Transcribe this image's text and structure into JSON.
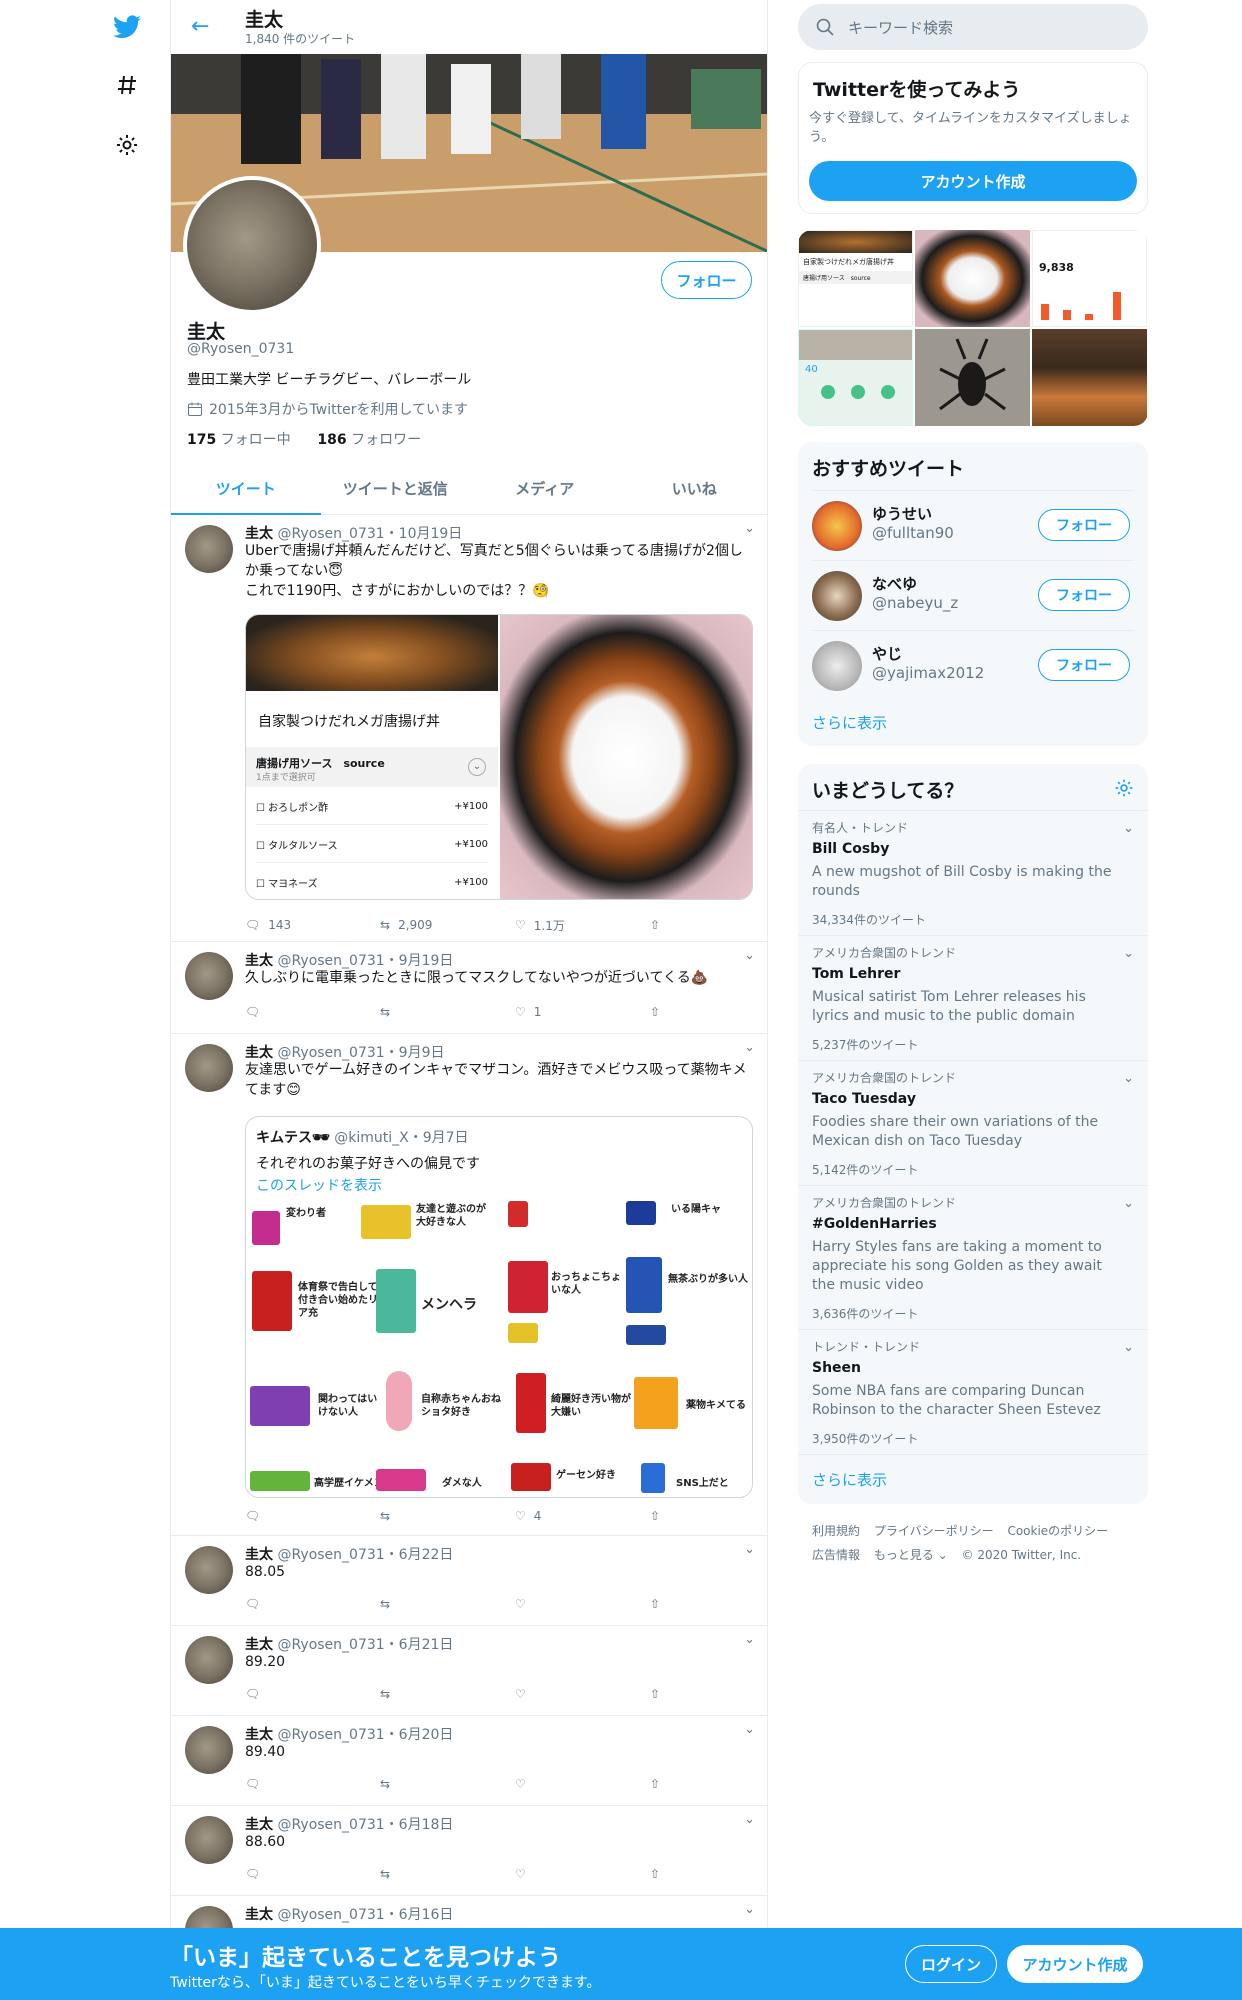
{
  "header": {
    "name": "圭太",
    "tweet_count": "1,840 件のツイート"
  },
  "profile": {
    "name": "圭太",
    "handle": "@Ryosen_0731",
    "bio": "豊田工業大学 ビーチラグビー、バレーボール",
    "joined": "2015年3月からTwitterを利用しています",
    "following_count": "175",
    "following_label": "フォロー中",
    "followers_count": "186",
    "followers_label": "フォロワー",
    "follow_button": "フォロー"
  },
  "tabs": [
    "ツイート",
    "ツイートと返信",
    "メディア",
    "いいね"
  ],
  "tweets": [
    {
      "name": "圭太",
      "meta": "@Ryosen_0731・10月19日",
      "text": "Uberで唐揚げ丼頼んだんだけど、写真だと5個ぐらいは乗ってる唐揚げが2個しか乗ってない😇\nこれで1190円、さすがにおかしいのでは？？🧐",
      "replies": "143",
      "retweets": "2,909",
      "likes": "1.1万"
    },
    {
      "name": "圭太",
      "meta": "@Ryosen_0731・9月19日",
      "text": "久しぶりに電車乗ったときに限ってマスクしてないやつが近づいてくる💩",
      "replies": "",
      "retweets": "",
      "likes": "1"
    },
    {
      "name": "圭太",
      "meta": "@Ryosen_0731・9月9日",
      "text": "友達思いでゲーム好きのインキャでマザコン。酒好きでメビウス吸って薬物キメてます😊",
      "replies": "",
      "retweets": "",
      "likes": "4"
    },
    {
      "name": "圭太",
      "meta": "@Ryosen_0731・6月22日",
      "text": "88.05",
      "replies": "",
      "retweets": "",
      "likes": ""
    },
    {
      "name": "圭太",
      "meta": "@Ryosen_0731・6月21日",
      "text": "89.20",
      "replies": "",
      "retweets": "",
      "likes": ""
    },
    {
      "name": "圭太",
      "meta": "@Ryosen_0731・6月20日",
      "text": "89.40",
      "replies": "",
      "retweets": "",
      "likes": ""
    },
    {
      "name": "圭太",
      "meta": "@Ryosen_0731・6月18日",
      "text": "88.60",
      "replies": "",
      "retweets": "",
      "likes": ""
    },
    {
      "name": "圭太",
      "meta": "@Ryosen_0731・6月16日",
      "text": "",
      "replies": "",
      "retweets": "",
      "likes": ""
    }
  ],
  "media1": {
    "title": "自家製つけだれメガ唐揚げ丼",
    "sauce_label": "唐揚げ用ソース　source",
    "sauce_sub": "1点まで選択可",
    "options": [
      {
        "name": "おろしポン酢",
        "price": "+¥100"
      },
      {
        "name": "タルタルソース",
        "price": "+¥100"
      },
      {
        "name": "マヨネーズ",
        "price": "+¥100"
      }
    ]
  },
  "quote": {
    "name": "キムテス🕶",
    "meta": "@kimuti_X・9月7日",
    "text": "それぞれのお菓子好きへの偏見です",
    "link": "このスレッドを表示",
    "labels": [
      "変わり者",
      "友達と遊ぶのが大好きな人",
      "いる陽キャ",
      "体育祭で告白して付き合い始めたリア充",
      "メンヘラ",
      "おっちょこちょいな人",
      "無茶ぶりが多い人",
      "関わってはいけない人",
      "自称赤ちゃんおねショタ好き",
      "綺麗好き汚い物が大嫌い",
      "薬物キメてる",
      "高学歴イケメン",
      "ダメな人",
      "ゲーセン好き",
      "SNS上だと"
    ]
  },
  "right": {
    "search_placeholder": "キーワード検索",
    "signup_title": "Twitterを使ってみよう",
    "signup_text": "今すぐ登録して、タイムラインをカスタマイズしましょう。",
    "signup_button": "アカウント作成",
    "grid_texts": {
      "menu": "自家製つけだれメガ唐揚げ丼",
      "sauce": "唐揚げ用ソース　source",
      "stat": "9,838",
      "step": "40"
    },
    "rec_title": "おすすめツイート",
    "recommendations": [
      {
        "name": "ゆうせい",
        "handle": "@fulltan90",
        "button": "フォロー"
      },
      {
        "name": "なべゆ",
        "handle": "@nabeyu_z",
        "button": "フォロー"
      },
      {
        "name": "やじ",
        "handle": "@yajimax2012",
        "button": "フォロー"
      }
    ],
    "rec_more": "さらに表示",
    "trends_title": "いまどうしてる？",
    "trends": [
      {
        "context": "有名人・トレンド",
        "title": "Bill Cosby",
        "desc": "A new mugshot of Bill Cosby is making the rounds",
        "count": "34,334件のツイート"
      },
      {
        "context": "アメリカ合衆国のトレンド",
        "title": "Tom Lehrer",
        "desc": "Musical satirist Tom Lehrer releases his lyrics and music to the public domain",
        "count": "5,237件のツイート"
      },
      {
        "context": "アメリカ合衆国のトレンド",
        "title": "Taco Tuesday",
        "desc": "Foodies share their own variations of the Mexican dish on Taco Tuesday",
        "count": "5,142件のツイート"
      },
      {
        "context": "アメリカ合衆国のトレンド",
        "title": "#GoldenHarries",
        "desc": "Harry Styles fans are taking a moment to appreciate his song Golden as they await the music video",
        "count": "3,636件のツイート"
      },
      {
        "context": "トレンド・トレンド",
        "title": "Sheen",
        "desc": "Some NBA fans are comparing Duncan Robinson to the character Sheen Estevez",
        "count": "3,950件のツイート"
      }
    ],
    "trends_more": "さらに表示",
    "footer": [
      "利用規約",
      "プライバシーポリシー",
      "Cookieのポリシー",
      "広告情報",
      "もっと見る ⌄",
      "© 2020 Twitter, Inc."
    ]
  },
  "bottom_bar": {
    "headline": "「いま」起きていることを見つけよう",
    "sub": "Twitterなら、「いま」起きていることをいち早くチェックできます。",
    "login": "ログイン",
    "signup": "アカウント作成"
  },
  "colors": {
    "accent": "#1da1f2",
    "text": "#14171a",
    "muted": "#657786",
    "border": "#e6ecf0"
  }
}
